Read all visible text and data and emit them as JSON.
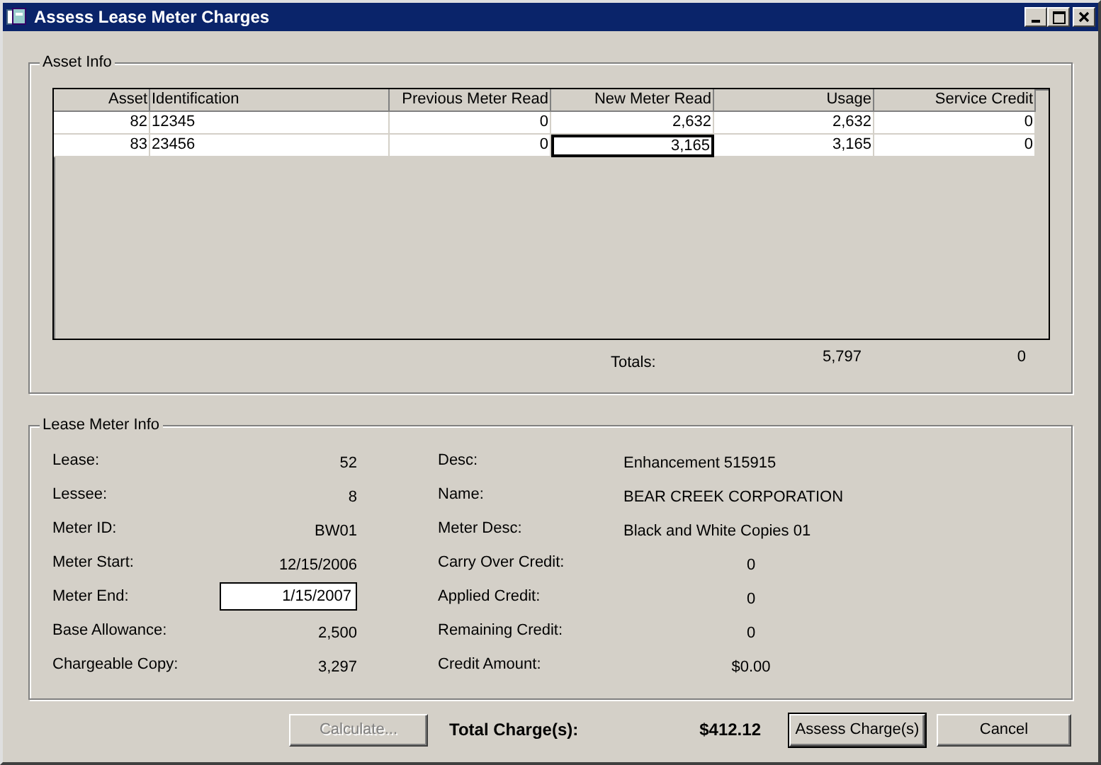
{
  "window": {
    "title": "Assess Lease Meter Charges"
  },
  "asset_info": {
    "title": "Asset Info",
    "columns": [
      "Asset",
      "Identification",
      "Previous Meter Read",
      "New Meter Read",
      "Usage",
      "Service Credit"
    ],
    "rows": [
      {
        "cells": [
          {
            "value": "82",
            "focused": false
          },
          {
            "value": "12345",
            "focused": false
          },
          {
            "value": "0",
            "focused": false
          },
          {
            "value": "2,632",
            "focused": false
          },
          {
            "value": "2,632",
            "focused": false
          },
          {
            "value": "0",
            "focused": false
          }
        ]
      },
      {
        "cells": [
          {
            "value": "83",
            "focused": false
          },
          {
            "value": "23456",
            "focused": false
          },
          {
            "value": "0",
            "focused": false
          },
          {
            "value": "3,165",
            "focused": true
          },
          {
            "value": "3,165",
            "focused": false
          },
          {
            "value": "0",
            "focused": false
          }
        ]
      }
    ],
    "totals": {
      "label": "Totals:",
      "usage": "5,797",
      "service_credit": "0"
    }
  },
  "lease_meter_info": {
    "title": "Lease Meter Info",
    "left": [
      {
        "label": "Lease:",
        "value": "52",
        "kind": "text"
      },
      {
        "label": "Lessee:",
        "value": "8",
        "kind": "text"
      },
      {
        "label": "Meter ID:",
        "value": "BW01",
        "kind": "text"
      },
      {
        "label": "Meter Start:",
        "value": "12/15/2006",
        "kind": "text"
      },
      {
        "label": "Meter End:",
        "value": "1/15/2007",
        "kind": "input"
      },
      {
        "label": "Base Allowance:",
        "value": "2,500",
        "kind": "text"
      },
      {
        "label": "Chargeable Copy:",
        "value": "3,297",
        "kind": "text"
      }
    ],
    "right": [
      {
        "label": "Desc:",
        "value": "Enhancement 515915",
        "kind": "text"
      },
      {
        "label": "Name:",
        "value": "BEAR CREEK CORPORATION",
        "kind": "text"
      },
      {
        "label": "Meter Desc:",
        "value": "Black and White Copies 01",
        "kind": "text"
      },
      {
        "label": "Carry Over Credit:",
        "value": "0",
        "kind": "amount"
      },
      {
        "label": "Applied Credit:",
        "value": "0",
        "kind": "amount"
      },
      {
        "label": "Remaining Credit:",
        "value": "0",
        "kind": "amount"
      },
      {
        "label": "Credit Amount:",
        "value": "$0.00",
        "kind": "amount"
      }
    ]
  },
  "footer": {
    "calculate": {
      "label": "Calculate...",
      "disabled": true
    },
    "total_label": "Total Charge(s):",
    "total_value": "$412.12",
    "assess": {
      "label": "Assess Charge(s)",
      "default": true
    },
    "cancel": {
      "label": "Cancel"
    }
  }
}
